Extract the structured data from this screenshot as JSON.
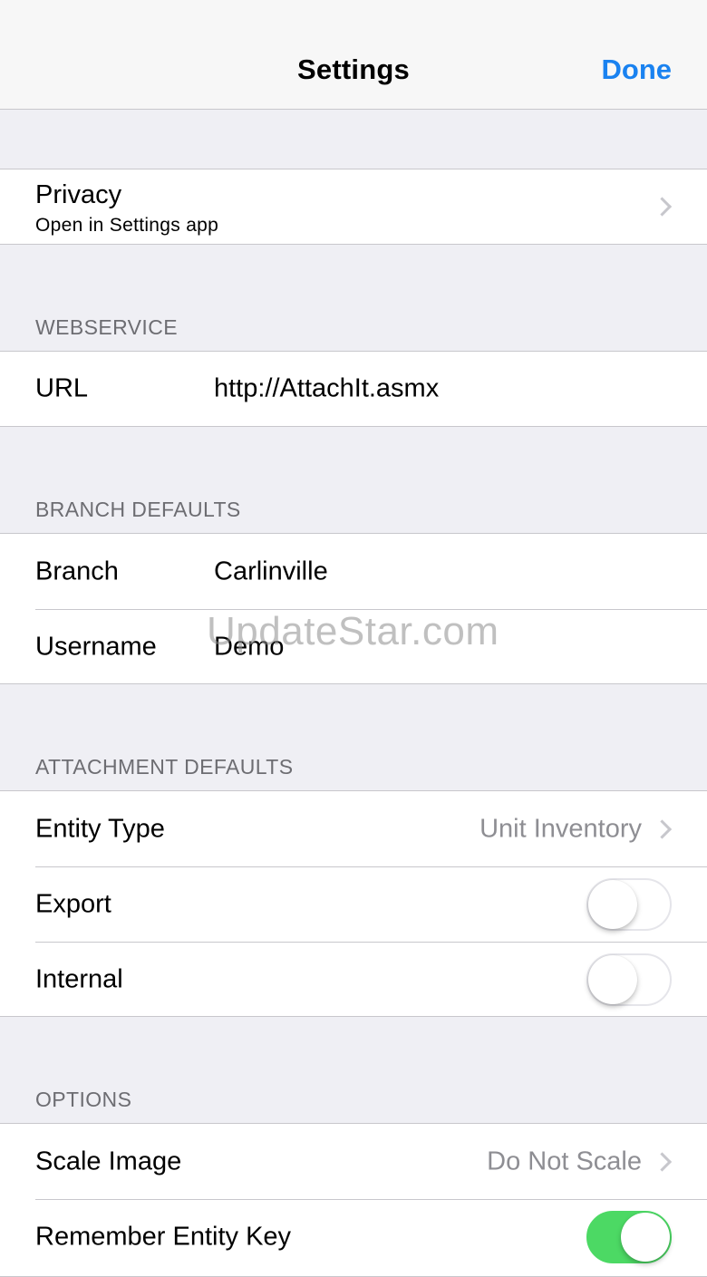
{
  "navbar": {
    "title": "Settings",
    "done_label": "Done"
  },
  "privacy": {
    "label": "Privacy",
    "subtitle": "Open in Settings app"
  },
  "webservice": {
    "header": "WEBSERVICE",
    "url_label": "URL",
    "url_value": "http://AttachIt.asmx"
  },
  "branch_defaults": {
    "header": "BRANCH DEFAULTS",
    "branch_label": "Branch",
    "branch_value": "Carlinville",
    "username_label": "Username",
    "username_value": "Demo"
  },
  "attachment_defaults": {
    "header": "ATTACHMENT DEFAULTS",
    "entity_type_label": "Entity Type",
    "entity_type_value": "Unit Inventory",
    "export_label": "Export",
    "export_on": false,
    "internal_label": "Internal",
    "internal_on": false
  },
  "options": {
    "header": "OPTIONS",
    "scale_image_label": "Scale Image",
    "scale_image_value": "Do Not Scale",
    "remember_entity_key_label": "Remember Entity Key",
    "remember_entity_key_on": true
  },
  "watermark": "UpdateStar.com",
  "colors": {
    "accent": "#1a82f0",
    "background": "#efeff4",
    "toggle_on": "#4cd964",
    "secondary_text": "#8e8e93"
  }
}
